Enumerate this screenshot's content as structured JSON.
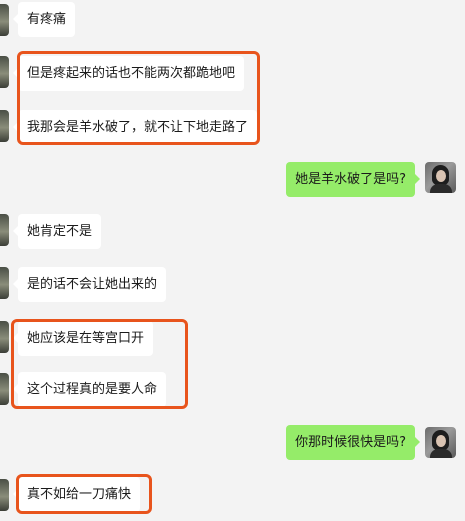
{
  "messages": [
    {
      "side": "in",
      "text": "有疼痛"
    },
    {
      "side": "in",
      "text": "但是疼起来的话也不能两次都跪地吧"
    },
    {
      "side": "in",
      "text": "我那会是羊水破了，就不让下地走路了"
    },
    {
      "side": "out",
      "text": "她是羊水破了是吗?"
    },
    {
      "side": "in",
      "text": "她肯定不是"
    },
    {
      "side": "in",
      "text": "是的话不会让她出来的"
    },
    {
      "side": "in",
      "text": "她应该是在等宫口开"
    },
    {
      "side": "in",
      "text": "这个过程真的是要人命"
    },
    {
      "side": "out",
      "text": "你那时候很快是吗?"
    },
    {
      "side": "in",
      "text": "真不如给一刀痛快"
    }
  ],
  "colors": {
    "background": "#f3f3f3",
    "incoming_bubble": "#ffffff",
    "outgoing_bubble": "#95ec69",
    "highlight_border": "#e8541c"
  },
  "icons": {
    "contact_avatar": "contact-avatar",
    "self_avatar": "self-avatar"
  }
}
